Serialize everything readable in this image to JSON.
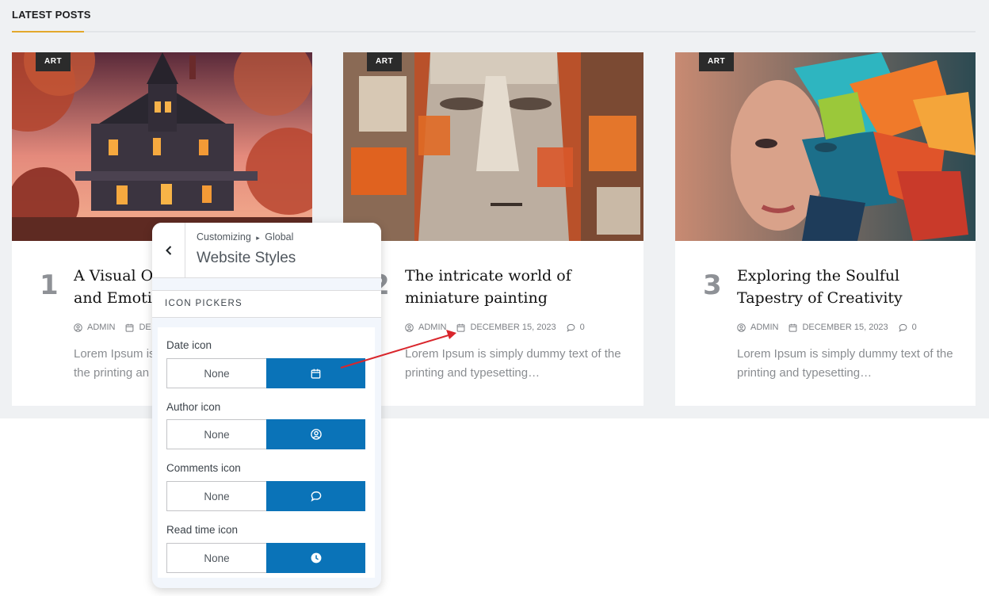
{
  "section": {
    "title": "LATEST POSTS"
  },
  "posts": [
    {
      "number": "1",
      "category": "ART",
      "title": "A Visual Od… and Emotio…",
      "author": "ADMIN",
      "date": "DE…",
      "excerpt": "Lorem Ipsum is… the printing an…"
    },
    {
      "number": "2",
      "category": "ART",
      "title": "The intricate world of miniature painting",
      "author": "ADMIN",
      "date": "DECEMBER 15, 2023",
      "comments": "0",
      "excerpt": "Lorem Ipsum is simply dummy text of the printing and typesetting…"
    },
    {
      "number": "3",
      "category": "ART",
      "title": "Exploring the Soulful Tapestry of Creativity",
      "author": "ADMIN",
      "date": "DECEMBER 15, 2023",
      "comments": "0",
      "excerpt": "Lorem Ipsum is simply dummy text of the printing and typesetting…"
    }
  ],
  "post1_title_lines": [
    "A Visual Od",
    "and Emotio"
  ],
  "post1_excerpt_lines": [
    "Lorem Ipsum is",
    "the printing an"
  ],
  "post1_date_partial": "DE",
  "customizer": {
    "breadcrumb_root": "Customizing",
    "breadcrumb_sep": "▸",
    "breadcrumb_leaf": "Global",
    "title": "Website Styles",
    "section_label": "ICON PICKERS",
    "controls": [
      {
        "label": "Date icon",
        "none_label": "None",
        "icon": "calendar-icon"
      },
      {
        "label": "Author icon",
        "none_label": "None",
        "icon": "user-circle-icon"
      },
      {
        "label": "Comments icon",
        "none_label": "None",
        "icon": "comment-icon"
      },
      {
        "label": "Read time icon",
        "none_label": "None",
        "icon": "clock-icon"
      }
    ]
  },
  "colors": {
    "accent": "#0a73b8",
    "underline": "#e3a82b",
    "badge": "#2b2b2b",
    "annotation": "#d9262c"
  }
}
